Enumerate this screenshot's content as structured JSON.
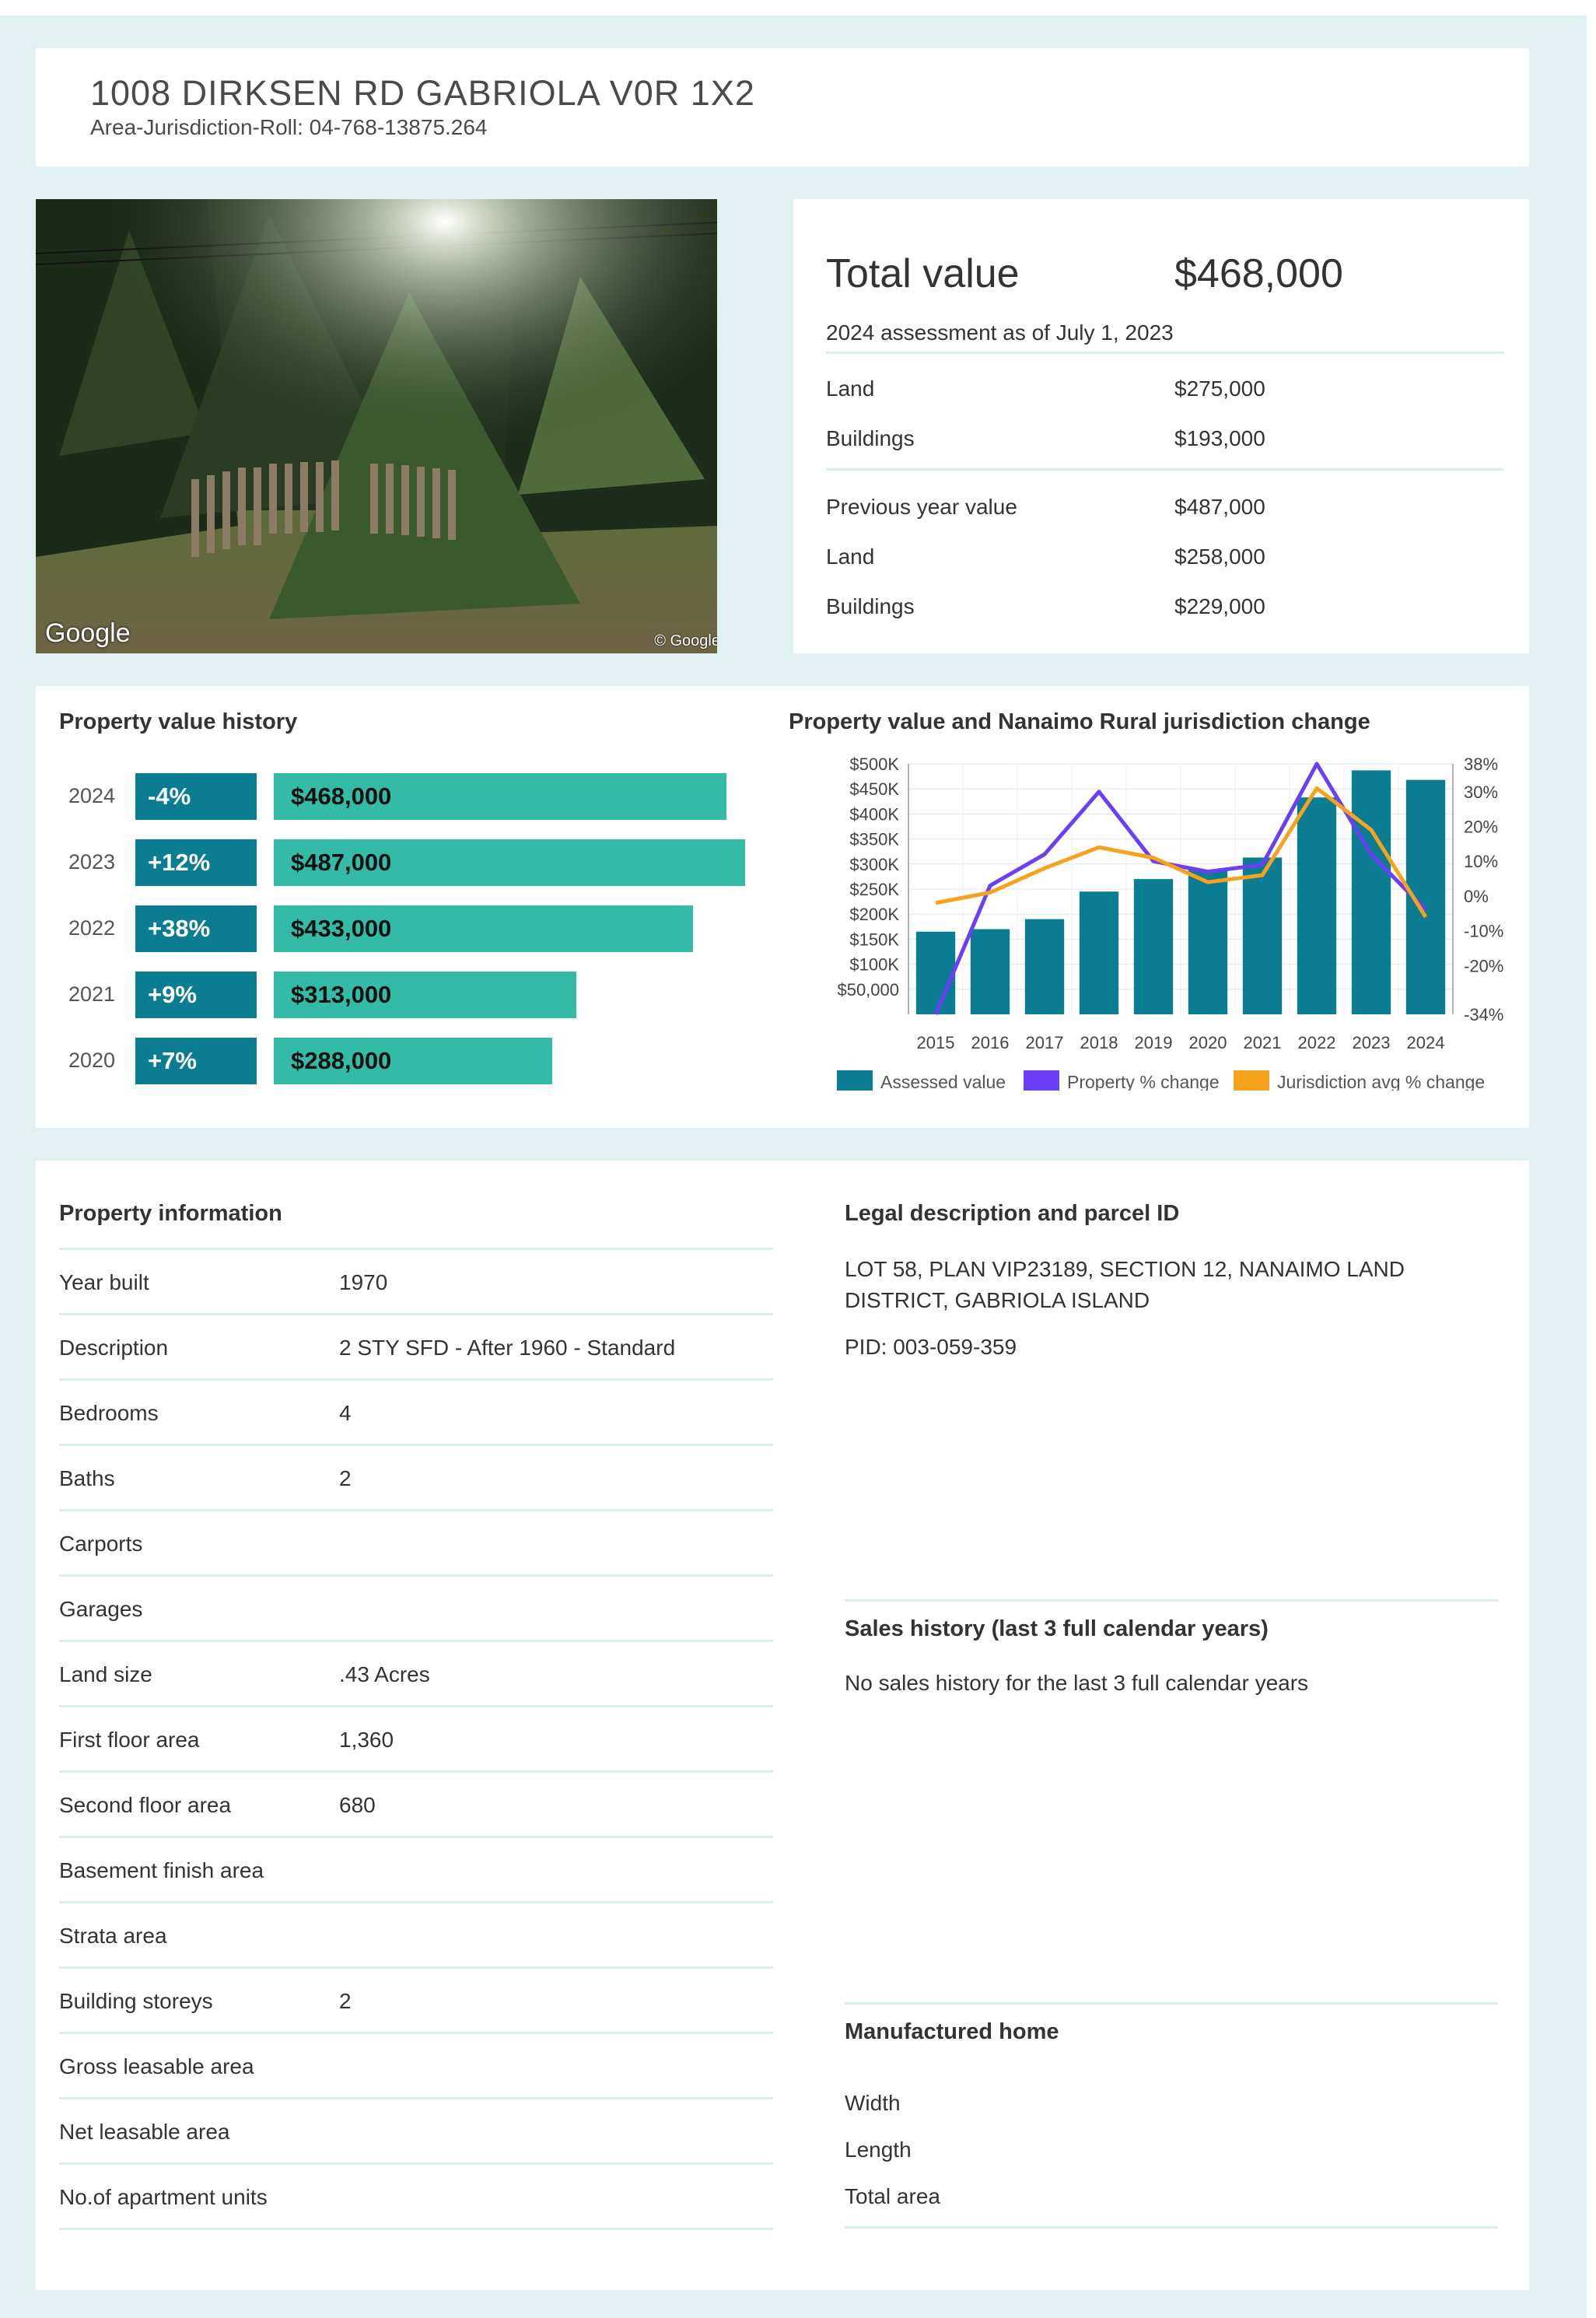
{
  "header": {
    "address": "1008 DIRKSEN RD GABRIOLA V0R 1X2",
    "roll": "Area-Jurisdiction-Roll: 04-768-13875.264"
  },
  "photo": {
    "google_logo": "Google",
    "copyright": "© Google"
  },
  "total": {
    "label": "Total value",
    "value": "$468,000",
    "assessment_note": "2024 assessment as of July 1, 2023",
    "land_label": "Land",
    "land_value": "$275,000",
    "buildings_label": "Buildings",
    "buildings_value": "$193,000",
    "prev_label": "Previous year value",
    "prev_value": "$487,000",
    "prev_land_label": "Land",
    "prev_land_value": "$258,000",
    "prev_buildings_label": "Buildings",
    "prev_buildings_value": "$229,000"
  },
  "history": {
    "title": "Property value history",
    "rows": [
      {
        "year": "2024",
        "change": "-4%",
        "value": "$468,000",
        "amount": 468000
      },
      {
        "year": "2023",
        "change": "+12%",
        "value": "$487,000",
        "amount": 487000
      },
      {
        "year": "2022",
        "change": "+38%",
        "value": "$433,000",
        "amount": 433000
      },
      {
        "year": "2021",
        "change": "+9%",
        "value": "$313,000",
        "amount": 313000
      },
      {
        "year": "2020",
        "change": "+7%",
        "value": "$288,000",
        "amount": 288000
      }
    ]
  },
  "chart_title": "Property value and Nanaimo Rural jurisdiction change",
  "chart_data": {
    "type": "bar",
    "title": "Property value and Nanaimo Rural jurisdiction change",
    "categories": [
      "2015",
      "2016",
      "2017",
      "2018",
      "2019",
      "2020",
      "2021",
      "2022",
      "2023",
      "2024"
    ],
    "series": [
      {
        "name": "Assessed value",
        "type": "bar",
        "axis": "left",
        "color": "#0b7d93",
        "values": [
          165000,
          170000,
          190000,
          245000,
          270000,
          288000,
          313000,
          433000,
          487000,
          468000
        ]
      },
      {
        "name": "Property % change",
        "type": "line",
        "axis": "right",
        "color": "#6b3ff5",
        "values": [
          -45,
          3,
          12,
          30,
          10,
          7,
          9,
          38,
          12,
          -4
        ]
      },
      {
        "name": "Jurisdiction avg % change",
        "type": "line",
        "axis": "right",
        "color": "#f7a21c",
        "values": [
          -2,
          1,
          8,
          14,
          11,
          4,
          6,
          31,
          19,
          -6
        ]
      }
    ],
    "left_ticks": [
      "$500K",
      "$450K",
      "$400K",
      "$350K",
      "$300K",
      "$250K",
      "$200K",
      "$150K",
      "$100K",
      "$50,000"
    ],
    "right_ticks": [
      "38%",
      "30%",
      "20%",
      "10%",
      "0%",
      "-10%",
      "-20%",
      "-34%"
    ],
    "ylim_left": [
      0,
      500000
    ],
    "ylim_right": [
      -34,
      38
    ],
    "grid": true,
    "legend": "bottom"
  },
  "property_info": {
    "title": "Property information",
    "rows": [
      {
        "label": "Year built",
        "value": "1970"
      },
      {
        "label": "Description",
        "value": "2 STY SFD - After 1960 - Standard"
      },
      {
        "label": "Bedrooms",
        "value": "4"
      },
      {
        "label": "Baths",
        "value": "2"
      },
      {
        "label": "Carports",
        "value": ""
      },
      {
        "label": "Garages",
        "value": ""
      },
      {
        "label": "Land size",
        "value": ".43 Acres"
      },
      {
        "label": "First floor area",
        "value": "1,360"
      },
      {
        "label": "Second floor area",
        "value": "680"
      },
      {
        "label": "Basement finish area",
        "value": ""
      },
      {
        "label": "Strata area",
        "value": ""
      },
      {
        "label": "Building storeys",
        "value": "2"
      },
      {
        "label": "Gross leasable area",
        "value": ""
      },
      {
        "label": "Net leasable area",
        "value": ""
      },
      {
        "label": "No.of apartment units",
        "value": ""
      }
    ]
  },
  "legal": {
    "title": "Legal description and parcel ID",
    "description_line1": "LOT 58, PLAN VIP23189, SECTION 12, NANAIMO LAND",
    "description_line2": "DISTRICT, GABRIOLA ISLAND",
    "pid": "PID: 003-059-359"
  },
  "sales": {
    "title": "Sales history (last 3 full calendar years)",
    "text": "No sales history for the last 3 full calendar years"
  },
  "manufactured": {
    "title": "Manufactured home",
    "width_label": "Width",
    "length_label": "Length",
    "total_label": "Total area"
  }
}
